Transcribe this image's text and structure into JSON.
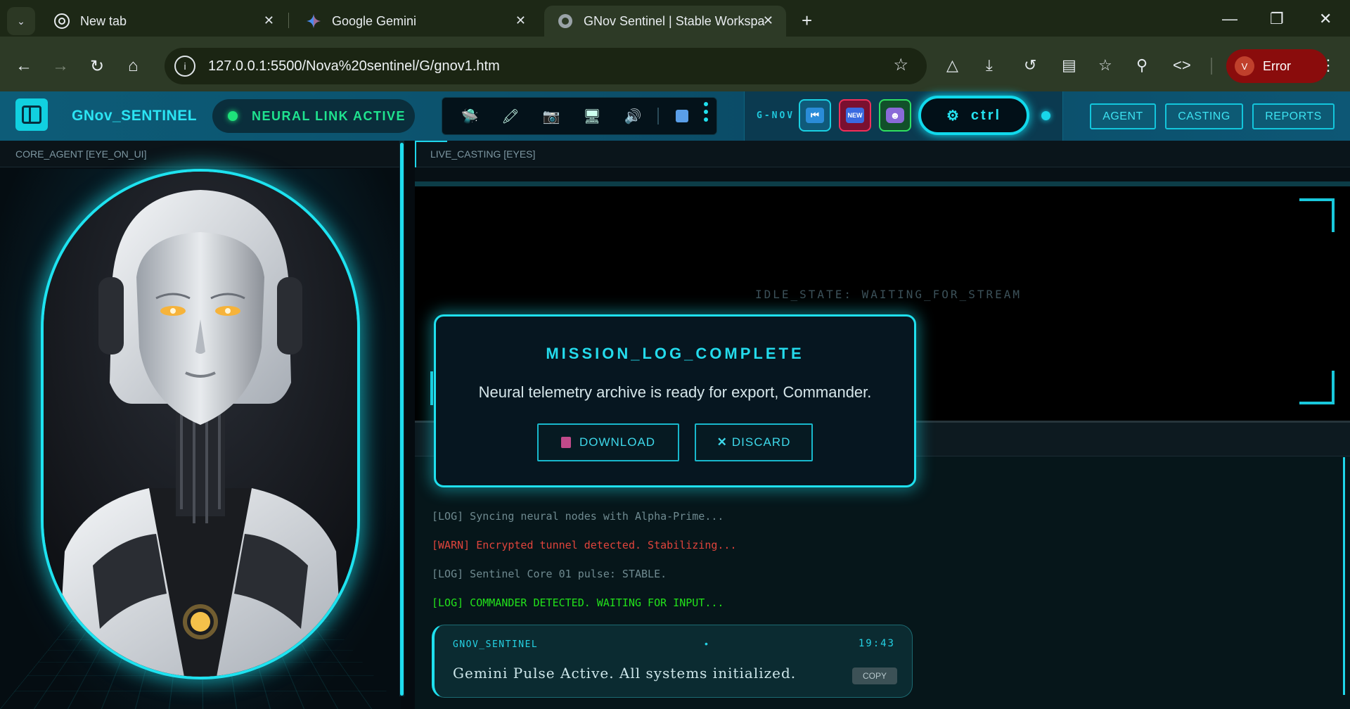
{
  "browser": {
    "tabs": [
      {
        "title": "New tab",
        "icon": "chrome-icon"
      },
      {
        "title": "Google Gemini",
        "icon": "gemini-icon"
      },
      {
        "title": "GNov Sentinel | Stable Workspa",
        "icon": "globe-icon"
      }
    ],
    "url": "127.0.0.1:5500/Nova%20sentinel/G/gnov1.htm",
    "profile_label": "Error",
    "profile_initial": "V"
  },
  "app": {
    "brand": "GNov_SENTINEL",
    "status": "NEURAL LINK ACTIVE",
    "gnov_label": "G-NOV",
    "ctrl_label": "ctrl",
    "gbtn_new": "NEW",
    "nav": [
      "AGENT",
      "CASTING",
      "REPORTS"
    ],
    "accent": "#1fe0ee"
  },
  "left_panel": {
    "title": "CORE_AGENT [EYE_ON_UI]"
  },
  "right_panel": {
    "title": "LIVE_CASTING [EYES]",
    "idle": "IDLE_STATE: WAITING_FOR_STREAM",
    "logs": [
      {
        "text": "[LOG] Syncing neural nodes with Alpha-Prime...",
        "color": "#6f8a90"
      },
      {
        "text": "[WARN] Encrypted tunnel detected. Stabilizing...",
        "color": "#e0443c"
      },
      {
        "text": "[LOG] Sentinel Core 01 pulse: STABLE.",
        "color": "#6f8a90"
      },
      {
        "text": "[LOG] COMMANDER DETECTED. WAITING FOR INPUT...",
        "color": "#22e21a"
      }
    ],
    "message": {
      "sender": "GNOV_SENTINEL",
      "dot": "•",
      "time": "19:43",
      "text": "Gemini Pulse Active. All systems initialized.",
      "copy_label": "COPY"
    }
  },
  "modal": {
    "title": "MISSION_LOG_COMPLETE",
    "message": "Neural telemetry archive is ready for export, Commander.",
    "download_label": "DOWNLOAD",
    "discard_label": "DISCARD"
  }
}
